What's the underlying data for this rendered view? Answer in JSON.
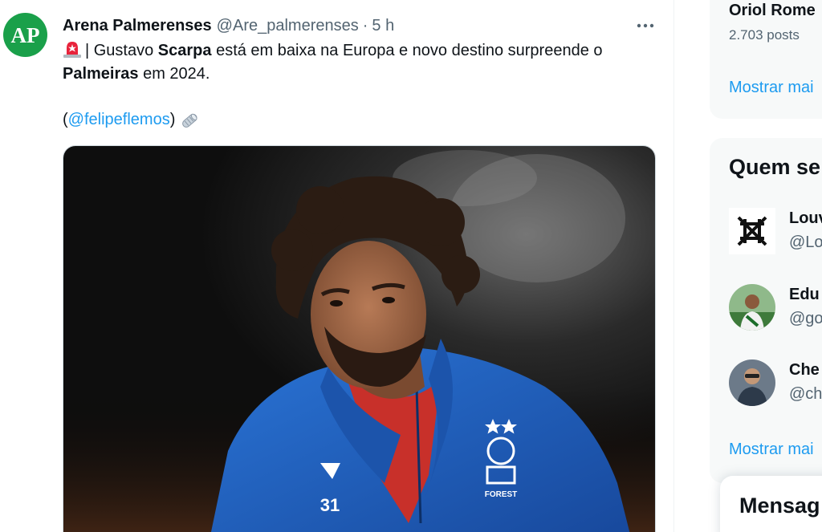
{
  "tweet": {
    "display_name": "Arena Palmerenses",
    "handle": "@Are_palmerenses",
    "separator": "·",
    "time": "5 h",
    "text_part1": "| Gustavo ",
    "text_bold1": "Scarpa",
    "text_part2": " está em baixa na Europa e novo destino surpreende o ",
    "text_bold2": "Palmeiras",
    "text_part3": " em 2024.",
    "mention_open": "(",
    "mention": "@felipeflemos",
    "mention_close": ")",
    "avatar_initials": "AP",
    "media_shirt_number": "31",
    "media_crest_text": "FOREST",
    "colors": {
      "avatar_bg": "#1aa04a",
      "link": "#1d9bf0",
      "jersey": "#1f5fb4"
    }
  },
  "sidebar": {
    "profile_name": "Oriol Rome",
    "profile_posts": "2.703 posts",
    "show_more": "Mostrar mai",
    "who_to_follow_title": "Quem se",
    "accounts": [
      {
        "name": "Louv",
        "handle": "@Lo"
      },
      {
        "name": "Edu",
        "handle": "@go"
      },
      {
        "name": "Che",
        "handle": "@ch"
      }
    ],
    "show_more_2": "Mostrar mai",
    "messages_title": "Mensag"
  },
  "icons": {
    "siren": "police-light-icon",
    "newspaper": "rolled-newspaper-icon",
    "more": "more-horizontal-icon"
  }
}
